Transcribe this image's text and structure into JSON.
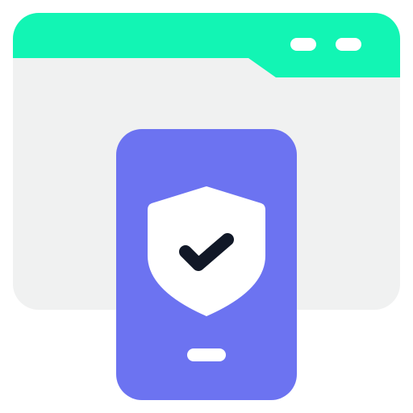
{
  "icon": {
    "name": "mobile-security-icon",
    "colors": {
      "window_header": "#12F5B4",
      "window_body": "#F0F1F1",
      "window_controls": "#FFFFFF",
      "phone_body": "#6C73F1",
      "shield_fill": "#FFFFFF",
      "checkmark": "#111827",
      "home_indicator": "#FFFFFF",
      "page_background": "#FFFFFF"
    },
    "parts": {
      "window": "browser-window-icon",
      "phone": "smartphone-icon",
      "shield": "shield-icon",
      "check": "checkmark-icon"
    }
  }
}
